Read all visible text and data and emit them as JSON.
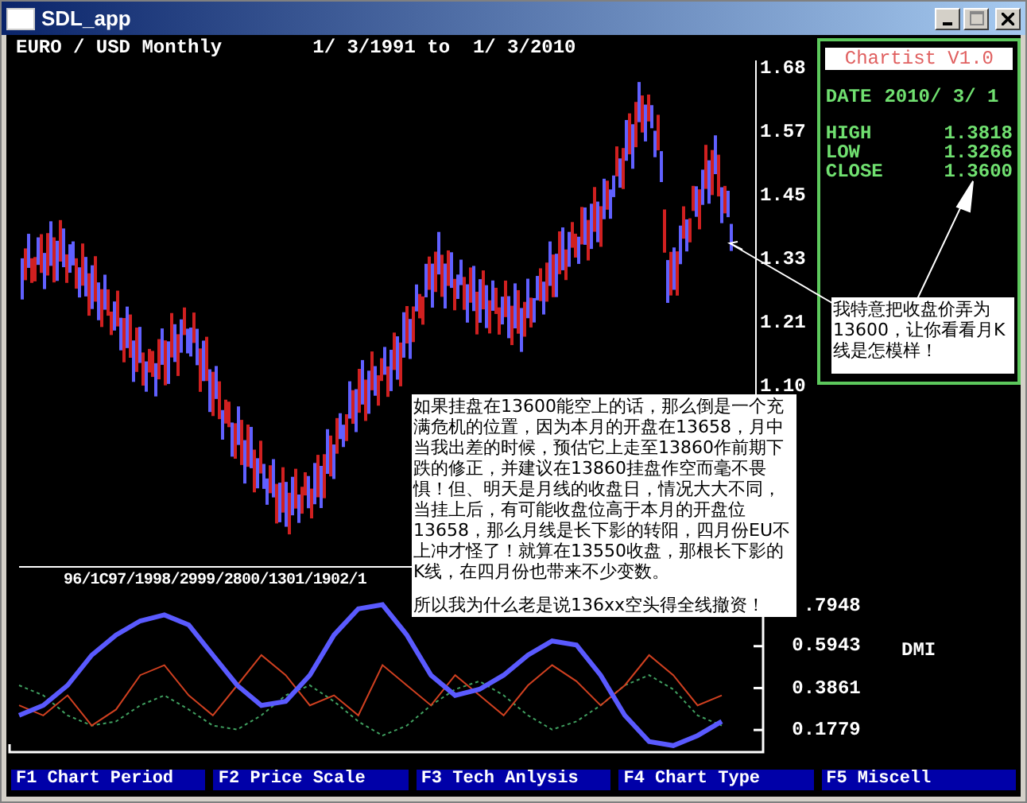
{
  "window": {
    "title": "SDL_app"
  },
  "chart_header": {
    "instrument": "EURO / USD Monthly",
    "date_range": "1/ 3/1991 to  1/ 3/2010"
  },
  "price_axis": [
    "1.68",
    "1.57",
    "1.45",
    "1.33",
    "1.21",
    "1.10"
  ],
  "time_axis_label": "96/1C97/1998/2999/2800/1301/1902/1",
  "indicator": {
    "name": "DMI",
    "chart_data": {
      "type": "line",
      "categories": [
        null,
        null,
        null,
        null,
        null,
        null,
        null,
        null,
        null,
        null,
        null,
        null,
        null,
        null,
        null,
        null,
        null,
        null,
        null,
        null,
        null,
        null,
        null,
        null,
        null,
        null,
        null,
        null,
        null,
        null
      ],
      "ylim": [
        0.06,
        0.85
      ],
      "yticks": [
        {
          "value": 0.7948,
          "label": ".7948"
        },
        {
          "value": 0.5943,
          "label": "0.5943"
        },
        {
          "value": 0.3861,
          "label": "0.3861"
        },
        {
          "value": 0.1779,
          "label": "0.1779"
        }
      ],
      "series": [
        {
          "color": "#40a060",
          "line_style": "dashed",
          "values": [
            0.4,
            0.35,
            0.25,
            0.2,
            0.22,
            0.3,
            0.35,
            0.28,
            0.2,
            0.18,
            0.25,
            0.35,
            0.4,
            0.32,
            0.22,
            0.15,
            0.2,
            0.3,
            0.38,
            0.42,
            0.35,
            0.25,
            0.18,
            0.22,
            0.3,
            0.4,
            0.45,
            0.38,
            0.25,
            0.2
          ]
        },
        {
          "color": "#d04020",
          "values": [
            0.3,
            0.25,
            0.35,
            0.2,
            0.28,
            0.45,
            0.5,
            0.35,
            0.25,
            0.4,
            0.55,
            0.45,
            0.3,
            0.35,
            0.25,
            0.5,
            0.4,
            0.3,
            0.45,
            0.35,
            0.25,
            0.4,
            0.5,
            0.42,
            0.3,
            0.4,
            0.55,
            0.45,
            0.3,
            0.35
          ]
        },
        {
          "color": "#5a5aff",
          "values": [
            0.25,
            0.3,
            0.4,
            0.55,
            0.65,
            0.72,
            0.75,
            0.7,
            0.55,
            0.4,
            0.3,
            0.32,
            0.45,
            0.65,
            0.78,
            0.8,
            0.65,
            0.45,
            0.35,
            0.38,
            0.45,
            0.55,
            0.62,
            0.6,
            0.45,
            0.25,
            0.12,
            0.1,
            0.15,
            0.22
          ]
        }
      ]
    }
  },
  "info_panel": {
    "title": "Chartist V1.0",
    "date_label": "DATE",
    "date": "2010/ 3/ 1",
    "values": [
      {
        "label": "HIGH",
        "value": "1.3818"
      },
      {
        "label": "LOW",
        "value": "1.3266"
      },
      {
        "label": "CLOSE",
        "value": "1.3600"
      }
    ]
  },
  "notes": [
    {
      "kind": "side",
      "paragraphs": [
        "我特意把收盘价弄为13600，让你看看月K线是怎模样！"
      ]
    },
    {
      "kind": "main",
      "paragraphs": [
        "如果挂盘在13600能空上的话，那么倒是一个充满危机的位置，因为本月的开盘在13658，月中当我出差的时候，预估它上走至13860作前期下跌的修正，并建议在13860挂盘作空而毫不畏惧！但、明天是月线的收盘日，情况大大不同，当挂上后，有可能收盘位高于本月的开盘位13658，那么月线是长下影的转阳，四月份EU不上冲才怪了！就算在13550收盘，那根长下影的K线，在四月份也带来不少变数。",
        "所以我为什么老是说136xx空头得全线撤资！"
      ]
    }
  ],
  "function_keys": [
    "F1 Chart Period",
    "F2 Price Scale",
    "F3 Tech Anlysis",
    "F4 Chart Type",
    "F5 Miscell"
  ]
}
